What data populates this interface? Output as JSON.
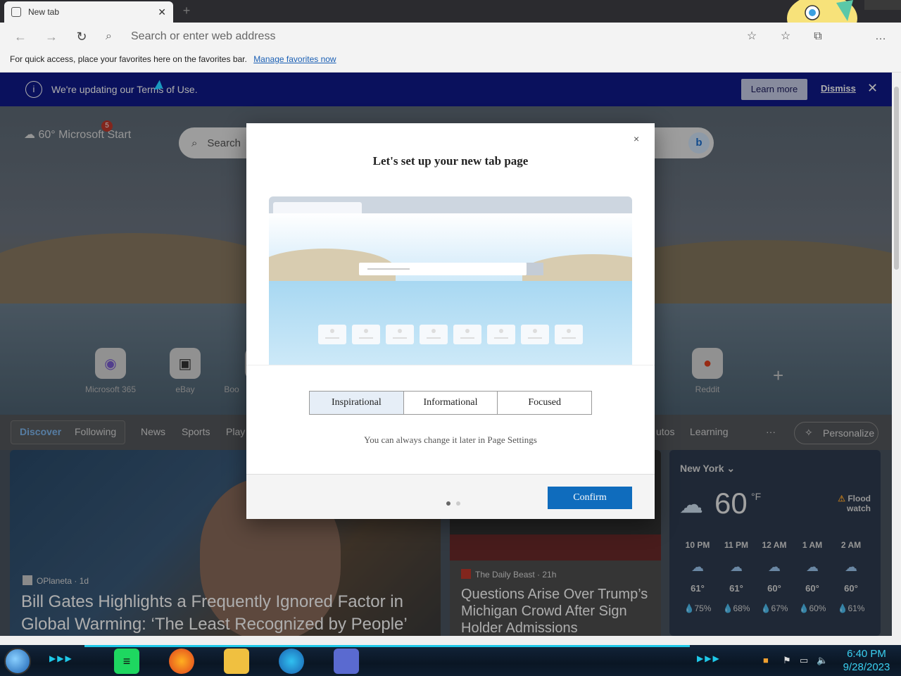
{
  "browser": {
    "tab_title": "New tab",
    "tab_close": "✕",
    "new_tab": "+",
    "address_placeholder": "Search or enter web address",
    "favorites_bar_text": "For quick access, place your favorites here on the favorites bar.",
    "favorites_bar_link": "Manage favorites now",
    "more_icon": "…"
  },
  "notice": {
    "info_icon": "i",
    "message": "We're updating our Terms of Use.",
    "learn_more": "Learn more",
    "dismiss": "Dismiss",
    "close": "✕"
  },
  "newtab": {
    "brand": "60°  Microsoft Start",
    "notification_count": "5",
    "search_placeholder": "Search",
    "quick_links": [
      {
        "label": "Microsoft 365"
      },
      {
        "label": "eBay"
      },
      {
        "label": "Boo"
      },
      {
        "label": "Reddit"
      }
    ],
    "add_link": "+"
  },
  "feed_nav": {
    "items": [
      "Discover",
      "Following",
      "News",
      "Sports",
      "Play",
      "utos",
      "Learning",
      "···"
    ],
    "personalize": "Personalize"
  },
  "cards": {
    "main": {
      "source": "OPlaneta · 1d",
      "headline": "Bill Gates Highlights a Frequently Ignored Factor in Global Warming: ‘The Least Recognized by People’"
    },
    "secondary": {
      "source": "The Daily Beast · 21h",
      "headline": "Questions Arise Over Trump’s Michigan Crowd After Sign Holder Admissions"
    }
  },
  "weather": {
    "city": "New York",
    "temperature": "60",
    "unit": "°F",
    "alert": "Flood watch",
    "hours": [
      {
        "time": "10 PM",
        "temp": "61°",
        "precip": "75%"
      },
      {
        "time": "11 PM",
        "temp": "61°",
        "precip": "68%"
      },
      {
        "time": "12 AM",
        "temp": "60°",
        "precip": "67%"
      },
      {
        "time": "1 AM",
        "temp": "60°",
        "precip": "60%"
      },
      {
        "time": "2 AM",
        "temp": "60°",
        "precip": "61%"
      }
    ]
  },
  "modal": {
    "close": "×",
    "title": "Let's set up your new tab page",
    "options": [
      "Inspirational",
      "Informational",
      "Focused"
    ],
    "selected": "Inspirational",
    "hint": "You can always change it later in Page Settings",
    "confirm": "Confirm",
    "page_indicator": {
      "current": 1,
      "total": 2
    }
  },
  "taskbar": {
    "time": "6:40 PM",
    "date": "9/28/2023"
  },
  "colors": {
    "notice_bg": "#0f1a8a",
    "confirm_bg": "#0f6cbd",
    "selected_option_bg": "#e6eef7"
  }
}
